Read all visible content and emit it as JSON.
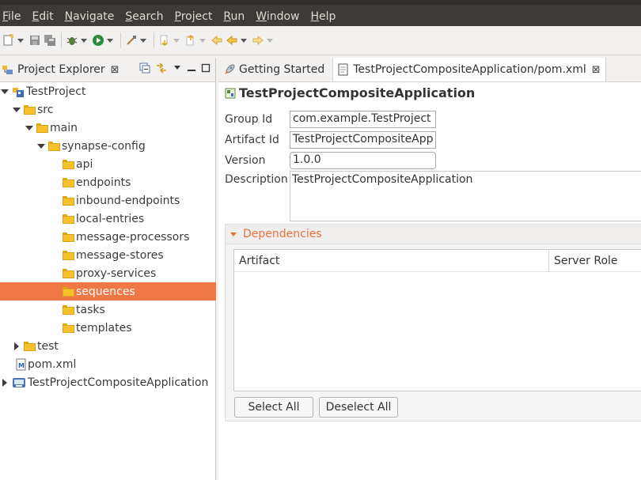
{
  "menu": {
    "items": [
      {
        "key": "F",
        "rest": "ile"
      },
      {
        "key": "E",
        "rest": "dit"
      },
      {
        "key": "N",
        "rest": "avigate"
      },
      {
        "key": "S",
        "rest": "earch"
      },
      {
        "key": "P",
        "rest": "roject"
      },
      {
        "key": "R",
        "rest": "un"
      },
      {
        "key": "W",
        "rest": "indow"
      },
      {
        "key": "H",
        "rest": "elp"
      }
    ]
  },
  "explorer": {
    "title": "Project Explorer",
    "close": "⊠",
    "tree": [
      {
        "label": "TestProject",
        "depth": 0,
        "twisty": "open",
        "icon": "project-icon"
      },
      {
        "label": "src",
        "depth": 1,
        "twisty": "open",
        "icon": "folder-icon"
      },
      {
        "label": "main",
        "depth": 2,
        "twisty": "open",
        "icon": "folder-icon"
      },
      {
        "label": "synapse-config",
        "depth": 3,
        "twisty": "open",
        "icon": "folder-icon"
      },
      {
        "label": "api",
        "depth": 4,
        "twisty": "none",
        "icon": "folder-icon"
      },
      {
        "label": "endpoints",
        "depth": 4,
        "twisty": "none",
        "icon": "folder-icon"
      },
      {
        "label": "inbound-endpoints",
        "depth": 4,
        "twisty": "none",
        "icon": "folder-icon"
      },
      {
        "label": "local-entries",
        "depth": 4,
        "twisty": "none",
        "icon": "folder-icon"
      },
      {
        "label": "message-processors",
        "depth": 4,
        "twisty": "none",
        "icon": "folder-icon"
      },
      {
        "label": "message-stores",
        "depth": 4,
        "twisty": "none",
        "icon": "folder-icon"
      },
      {
        "label": "proxy-services",
        "depth": 4,
        "twisty": "none",
        "icon": "folder-icon"
      },
      {
        "label": "sequences",
        "depth": 4,
        "twisty": "none",
        "icon": "folder-icon",
        "selected": true
      },
      {
        "label": "tasks",
        "depth": 4,
        "twisty": "none",
        "icon": "folder-icon"
      },
      {
        "label": "templates",
        "depth": 4,
        "twisty": "none",
        "icon": "folder-icon"
      },
      {
        "label": "test",
        "depth": 1,
        "twisty": "closed",
        "icon": "folder-icon"
      },
      {
        "label": "pom.xml",
        "depth": 1,
        "twisty": "none",
        "icon": "maven-file-icon"
      },
      {
        "label": "TestProjectCompositeApplication",
        "depth": 0,
        "twisty": "closed",
        "icon": "composite-project-icon"
      }
    ]
  },
  "editor": {
    "tabs": [
      {
        "label": "Getting Started",
        "icon": "rocket-icon"
      },
      {
        "label": "TestProjectCompositeApplication/pom.xml",
        "icon": "file-icon",
        "active": true,
        "close": "⊠"
      }
    ],
    "form_title": "TestProjectCompositeApplication",
    "fields": {
      "group_id": {
        "label": "Group Id",
        "value": "com.example.TestProject"
      },
      "artifact_id": {
        "label": "Artifact Id",
        "value": "TestProjectCompositeApp"
      },
      "version": {
        "label": "Version",
        "value": "1.0.0"
      },
      "description": {
        "label": "Description",
        "value": "TestProjectCompositeApplication"
      }
    },
    "dependencies": {
      "title": "Dependencies",
      "columns": [
        "Artifact",
        "Server Role"
      ],
      "select_all": "Select All",
      "deselect_all": "Deselect All"
    }
  },
  "colors": {
    "selection": "#f07746",
    "section_title": "#e8703a",
    "menubar": "#3c3b37"
  }
}
